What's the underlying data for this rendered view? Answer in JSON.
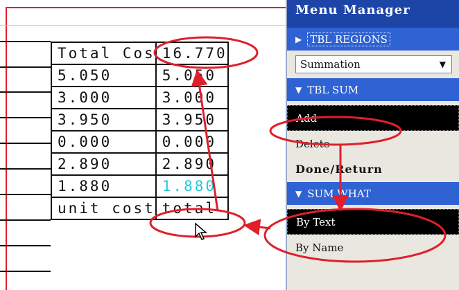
{
  "menu_manager": {
    "title": "Menu Manager",
    "section_regions": {
      "label": "TBL REGIONS"
    },
    "dropdown": {
      "selected": "Summation"
    },
    "section_sum": {
      "label": "TBL SUM"
    },
    "sum_items": [
      {
        "label": "Add",
        "selected": true
      },
      {
        "label": "Delete",
        "selected": false
      },
      {
        "label": "Done/Return",
        "selected": false
      }
    ],
    "section_sum_what": {
      "label": "SUM WHAT"
    },
    "sum_what_items": [
      {
        "label": "By Text",
        "selected": true
      },
      {
        "label": "By Name",
        "selected": false
      }
    ]
  },
  "table": {
    "rows": [
      [
        "Total Cos",
        "16.770"
      ],
      [
        "5.050",
        "5.050"
      ],
      [
        "3.000",
        "3.000"
      ],
      [
        "3.950",
        "3.950"
      ],
      [
        "0.000",
        "0.000"
      ],
      [
        "2.890",
        "2.890"
      ],
      [
        "1.880",
        "1.880"
      ],
      [
        "unit cost",
        "total"
      ]
    ]
  },
  "colors": {
    "annotation_red": "#e01f2a",
    "title_bar": "#1d45a8",
    "section_header": "#2f62d3",
    "panel_bg": "#e9e7e0",
    "highlight_cell_text": "#23c6d6"
  }
}
